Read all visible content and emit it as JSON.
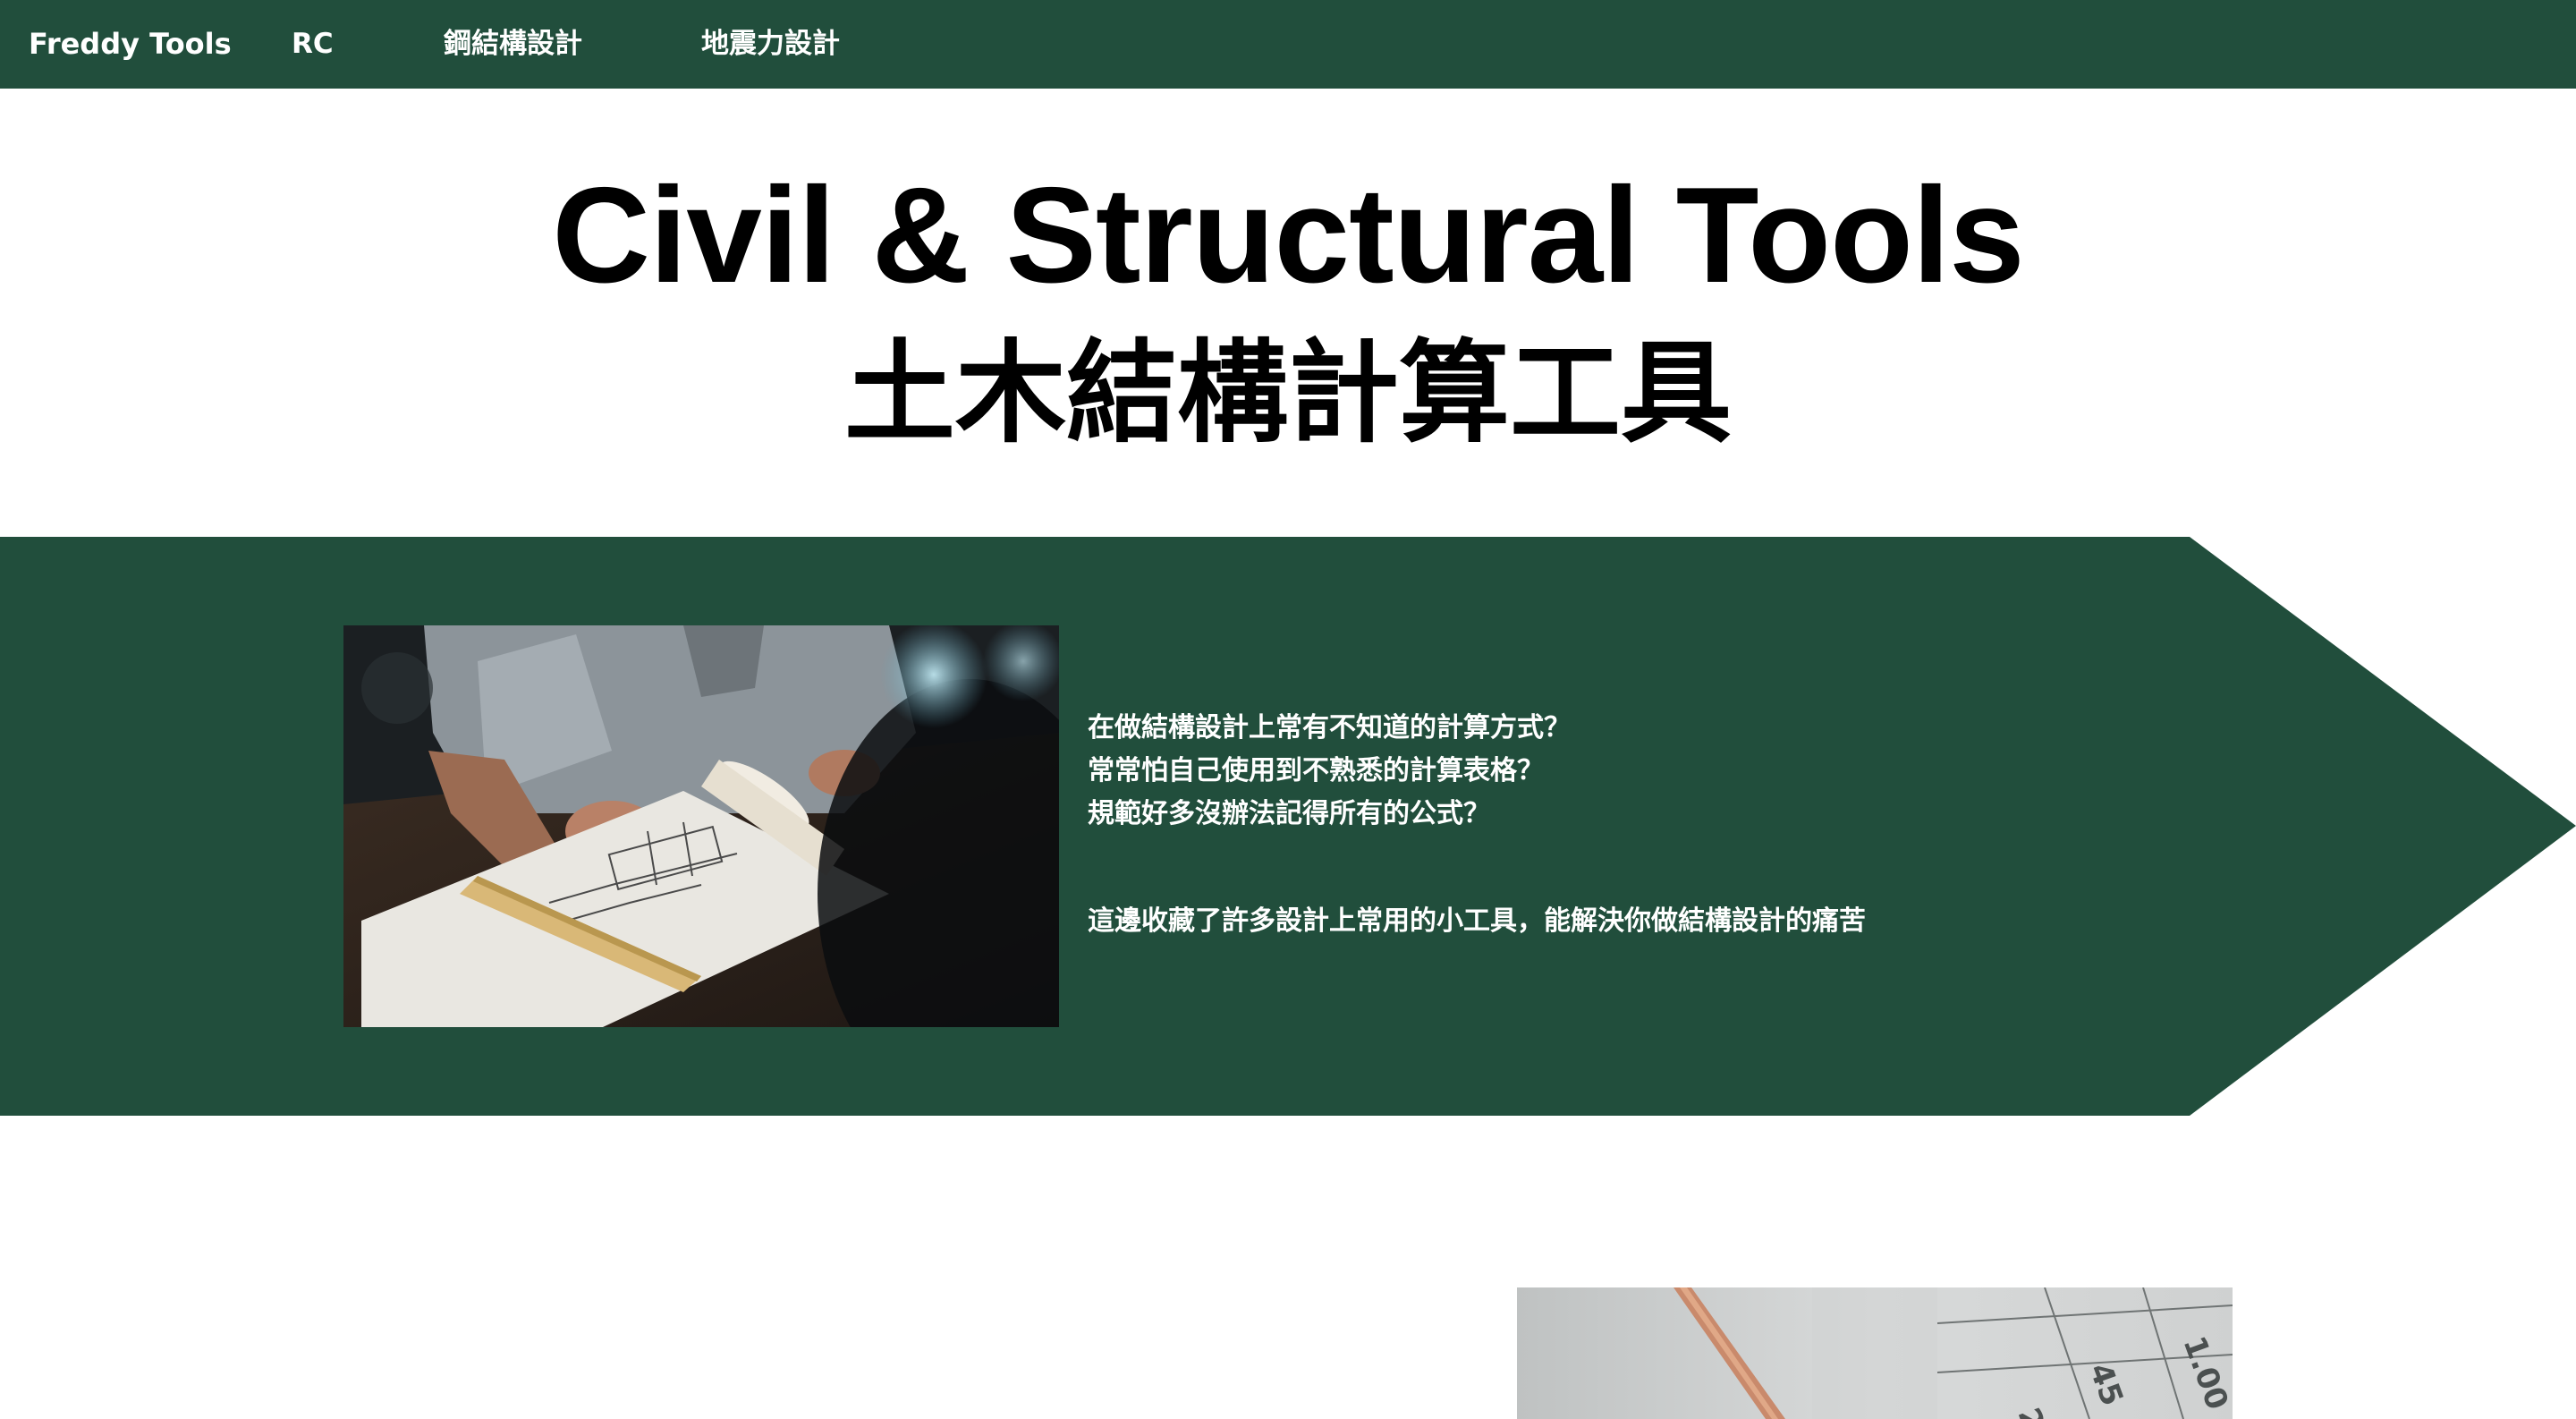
{
  "nav": {
    "brand": "Freddy Tools",
    "items": [
      {
        "label": "RC"
      },
      {
        "label": "鋼結構設計"
      },
      {
        "label": "地震力設計"
      }
    ]
  },
  "hero": {
    "title": "Civil & Structural Tools",
    "subtitle": "土木結構計算工具"
  },
  "banner": {
    "lines": [
      "在做結構設計上常有不知道的計算方式？",
      "常常怕自己使用到不熟悉的計算表格？",
      "規範好多沒辦法記得所有的公式？"
    ],
    "summary": "這邊收藏了許多設計上常用的小工具，能解決你做結構設計的痛苦"
  },
  "colors": {
    "brand_green": "#214e3c",
    "text_on_green": "#ffffff",
    "heading": "#000000"
  }
}
